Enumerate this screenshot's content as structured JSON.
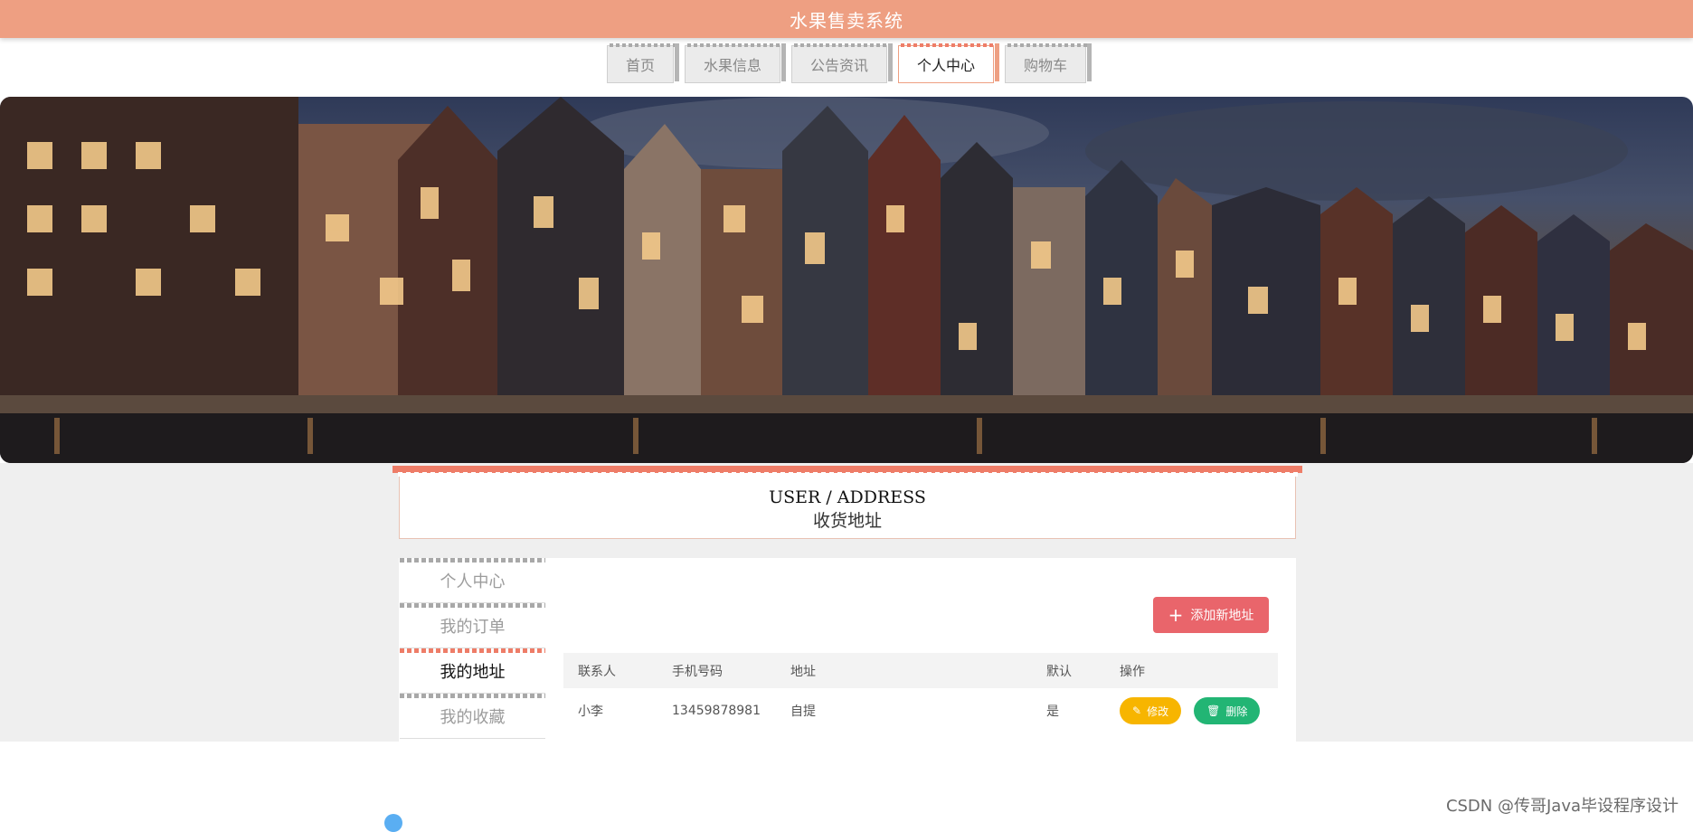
{
  "app": {
    "title": "水果售卖系统"
  },
  "nav": {
    "tabs": [
      {
        "label": "首页",
        "active": false
      },
      {
        "label": "水果信息",
        "active": false
      },
      {
        "label": "公告资讯",
        "active": false
      },
      {
        "label": "个人中心",
        "active": true
      },
      {
        "label": "购物车",
        "active": false
      }
    ]
  },
  "page_header": {
    "en": "USER / ADDRESS",
    "cn": "收货地址"
  },
  "sidebar": {
    "items": [
      {
        "label": "个人中心",
        "active": false
      },
      {
        "label": "我的订单",
        "active": false
      },
      {
        "label": "我的地址",
        "active": true
      },
      {
        "label": "我的收藏",
        "active": false
      }
    ]
  },
  "toolbar": {
    "add_label": "添加新地址",
    "add_icon": "plus-icon"
  },
  "table": {
    "headers": [
      "联系人",
      "手机号码",
      "地址",
      "默认",
      "操作"
    ],
    "rows": [
      {
        "contact": "小李",
        "phone": "13459878981",
        "address": "自提",
        "default": "是",
        "edit_label": "修改",
        "delete_label": "删除"
      }
    ]
  },
  "colors": {
    "accent": "#ee9f82",
    "edit": "#f7b500",
    "delete": "#22b574",
    "add": "#e9656b"
  },
  "watermark": "CSDN @传哥Java毕设程序设计"
}
